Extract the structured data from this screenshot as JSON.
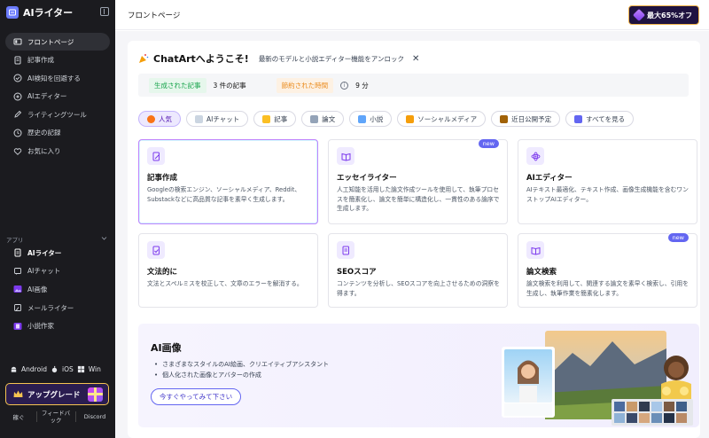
{
  "app": {
    "name": "AIライター"
  },
  "sidebar": {
    "nav": [
      {
        "label": "フロントページ",
        "icon": "home-icon",
        "active": true
      },
      {
        "label": "記事作成",
        "icon": "document-icon"
      },
      {
        "label": "AI検知を回避する",
        "icon": "shield-check-icon"
      },
      {
        "label": "AIエディター",
        "icon": "sparkle-icon"
      },
      {
        "label": "ライティングツール",
        "icon": "pen-icon"
      },
      {
        "label": "歴史の記録",
        "icon": "history-icon"
      },
      {
        "label": "お気に入り",
        "icon": "heart-icon"
      }
    ],
    "apps_label": "アプリ",
    "apps": [
      {
        "label": "AIライター",
        "icon": "writer-icon",
        "bold": true
      },
      {
        "label": "AIチャット",
        "icon": "chat-icon"
      },
      {
        "label": "AI画像",
        "icon": "image-icon"
      },
      {
        "label": "メールライター",
        "icon": "mail-icon"
      },
      {
        "label": "小説作家",
        "icon": "book-icon"
      }
    ],
    "platforms": {
      "android": "Android",
      "ios": "iOS",
      "win": "Win"
    },
    "upgrade_label": "アップグレード",
    "footer": [
      "稼ぐ",
      "フィードバック",
      "Discord"
    ]
  },
  "header": {
    "title": "フロントページ",
    "promo": "最大65%オフ"
  },
  "welcome": {
    "title": "ChatArtへようこそ!",
    "subtitle": "最新のモデルと小説エディター機能をアンロック"
  },
  "stats": {
    "articles_label": "生成された記事",
    "articles_value": "3 件の記事",
    "saved_label": "節約された時間",
    "saved_value": "9 分"
  },
  "chips": [
    {
      "label": "人気",
      "active": true,
      "color": "#f97316"
    },
    {
      "label": "AIチャット",
      "color": "#cbd5e1"
    },
    {
      "label": "記事",
      "color": "#fbbf24"
    },
    {
      "label": "論文",
      "color": "#94a3b8"
    },
    {
      "label": "小説",
      "color": "#60a5fa"
    },
    {
      "label": "ソーシャルメディア",
      "color": "#f59e0b"
    },
    {
      "label": "近日公開予定",
      "color": "#a16207"
    },
    {
      "label": "すべてを見る",
      "color": "#6366f1"
    }
  ],
  "cards": [
    {
      "title": "記事作成",
      "desc": "Googleの検索エンジン、ソーシャルメディア、Reddit、Substackなどに高品質な記事を素早く生成します。",
      "icon": "doc-edit-icon"
    },
    {
      "title": "エッセイライター",
      "desc": "人工知能を活用した論文作成ツールを使用して、執筆プロセスを簡素化し、論文を簡単に構造化し、一貫性のある論序で生成します。",
      "icon": "book-open-icon",
      "badge": "new"
    },
    {
      "title": "AIエディター",
      "desc": "AIテキスト最適化、テキスト作成、画像生成機能を含むワンストップAIエディター。",
      "icon": "atom-icon"
    },
    {
      "title": "文法的に",
      "desc": "文法とスペルミスを校正して、文章のエラーを解消する。",
      "icon": "doc-check-icon"
    },
    {
      "title": "SEOスコア",
      "desc": "コンテンツを分析し、SEOスコアを向上させるための洞察を得ます。",
      "icon": "seo-doc-icon"
    },
    {
      "title": "論文検索",
      "desc": "論文検索を利用して、関連する論文を素早く検索し、引用を生成し、執筆作業を簡素化します。",
      "icon": "book-open-icon",
      "badge": "new"
    }
  ],
  "banner": {
    "title": "AI画像",
    "bullets": [
      "さまざまなスタイルのAI絵画、クリエイティブアシスタント",
      "個人化された画像とアバターの作成"
    ],
    "button": "今すぐやってみて下さい"
  },
  "colors": {
    "sidebar_bg": "#1b1b1f",
    "accent": "#6366f1",
    "upgrade_border": "#f5c451"
  }
}
